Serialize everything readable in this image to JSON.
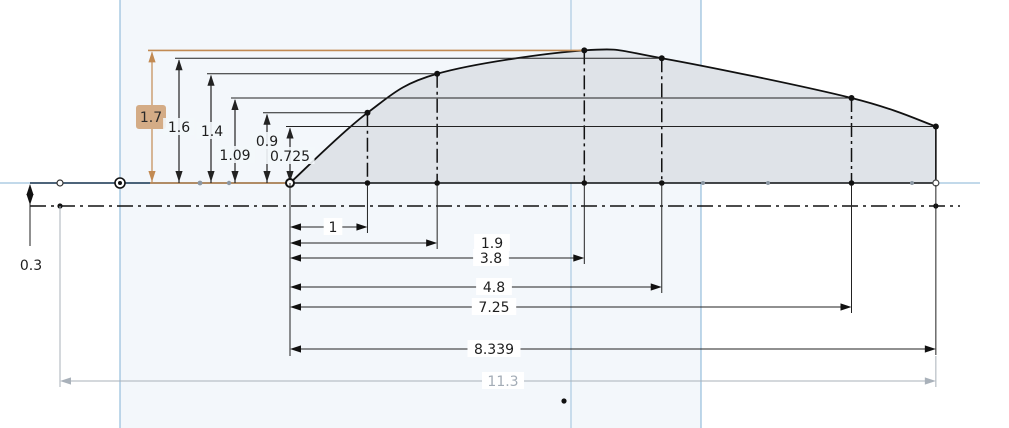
{
  "colors": {
    "background": "#ffffff",
    "plane_fill": "#f3f7fb",
    "plane_edge": "#9dc2de",
    "profile_fill": "#dfe3e8",
    "sketch_line": "#111111",
    "dimension_line": "#111111",
    "highlight": "#c28a52",
    "highlight_box": "#d4ac86",
    "grey_dimension": "#a9b1ba"
  },
  "sketch": {
    "x_unit_label": "",
    "profile_points": [
      {
        "x": 0,
        "height": 0
      },
      {
        "x": 1,
        "height": 0.9
      },
      {
        "x": 1.9,
        "height": 1.4
      },
      {
        "x": 3.8,
        "height": 1.7
      },
      {
        "x": 4.8,
        "height": 1.6
      },
      {
        "x": 7.25,
        "height": 1.09
      },
      {
        "x": 8.339,
        "height": 0.725
      }
    ],
    "horizontal_dimensions": [
      {
        "label": "1",
        "value": 1
      },
      {
        "label": "1.9",
        "value": 1.9
      },
      {
        "label": "3.8",
        "value": 3.8
      },
      {
        "label": "4.8",
        "value": 4.8
      },
      {
        "label": "7.25",
        "value": 7.25
      },
      {
        "label": "8.339",
        "value": 8.339
      }
    ],
    "vertical_dimensions": [
      {
        "label": "1.7",
        "value": 1.7,
        "highlighted": true
      },
      {
        "label": "1.6",
        "value": 1.6,
        "highlighted": false
      },
      {
        "label": "1.4",
        "value": 1.4,
        "highlighted": false
      },
      {
        "label": "1.09",
        "value": 1.09,
        "highlighted": false
      },
      {
        "label": "0.9",
        "value": 0.9,
        "highlighted": false
      },
      {
        "label": "0.725",
        "value": 0.725,
        "highlighted": false
      }
    ],
    "offset_dimension": {
      "label": "0.3",
      "value": 0.3
    },
    "overall_dimension": {
      "label": "11.3",
      "value": 11.3
    }
  }
}
